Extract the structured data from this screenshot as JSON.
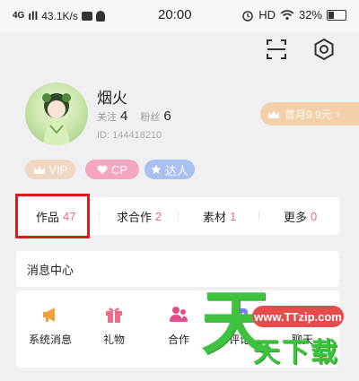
{
  "status_bar": {
    "network": "4G",
    "signal": "ıll",
    "speed": "43.1K/s",
    "time": "20:00",
    "hd": "HD",
    "battery": "32%"
  },
  "profile": {
    "username": "烟火",
    "following_label": "关注",
    "following_count": "4",
    "fans_label": "粉丝",
    "fans_count": "6",
    "user_id": "ID: 144418210"
  },
  "promo": {
    "label": "首月9.9元",
    "arrow": "›"
  },
  "badges": [
    {
      "label": "VIP",
      "color": "#f1d7c2"
    },
    {
      "label": "CP",
      "color": "#f5a6c3"
    },
    {
      "label": "达人",
      "color": "#a9c1f0"
    }
  ],
  "tabs": [
    {
      "label": "作品",
      "count": "47"
    },
    {
      "label": "求合作",
      "count": "2"
    },
    {
      "label": "素材",
      "count": "1"
    },
    {
      "label": "更多",
      "count": "0"
    }
  ],
  "message_center": {
    "title": "消息中心",
    "items": [
      {
        "label": "系统消息",
        "icon": "megaphone-icon",
        "color": "#f0a23a"
      },
      {
        "label": "礼物",
        "icon": "gift-icon",
        "color": "#f06a8c"
      },
      {
        "label": "合作",
        "icon": "people-icon",
        "color": "#e0508a"
      },
      {
        "label": "评论",
        "icon": "comment-icon",
        "color": "#7b7bf0"
      },
      {
        "label": "聊天",
        "icon": "chat-icon",
        "color": "#f0a23a"
      }
    ]
  },
  "watermark": {
    "glyph": "天",
    "url": "www.TTzip.com",
    "brand": "天下载"
  },
  "colors": {
    "accent_pink": "#f06a8c",
    "highlight_red": "#e0191b",
    "watermark_green": "#3fc23f"
  }
}
